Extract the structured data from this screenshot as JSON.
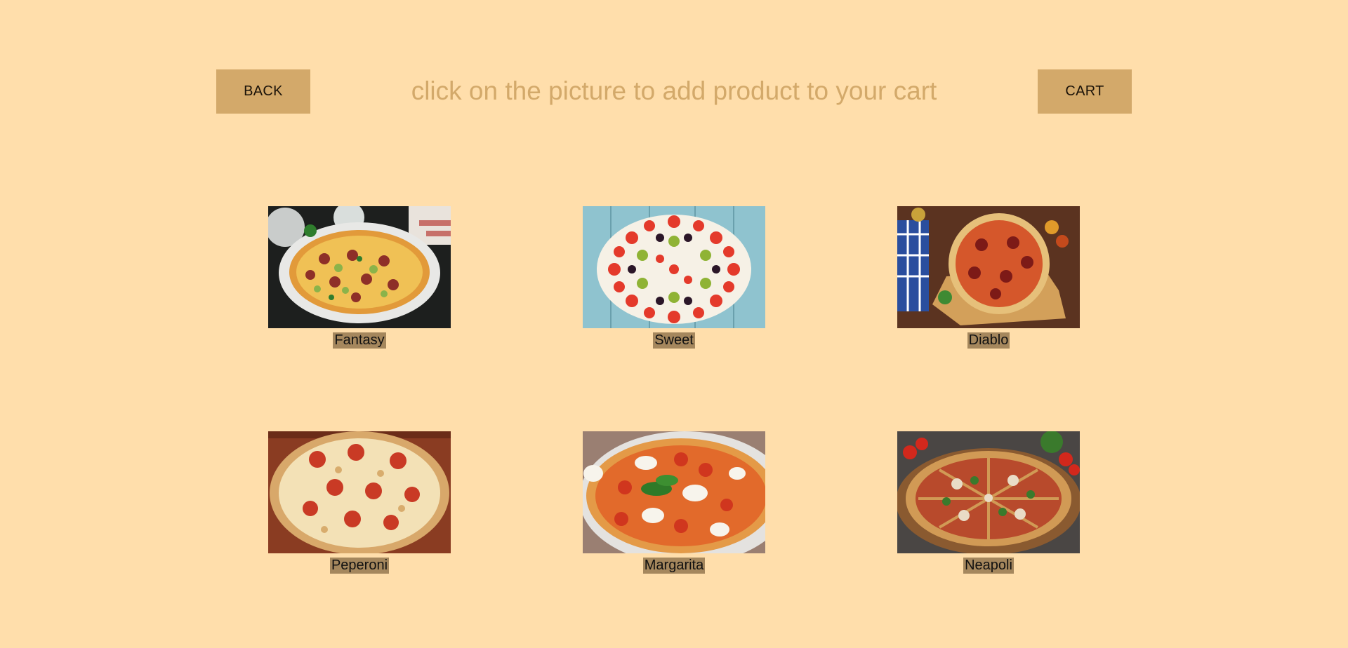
{
  "header": {
    "back_label": "BACK",
    "title": "click on the picture to add product to your cart",
    "cart_label": "CART"
  },
  "products": [
    {
      "name": "Fantasy",
      "image": "pizza-fantasy-image"
    },
    {
      "name": "Sweet",
      "image": "pizza-sweet-image"
    },
    {
      "name": "Diablo",
      "image": "pizza-diablo-image"
    },
    {
      "name": "Peperoni",
      "image": "pizza-peperoni-image"
    },
    {
      "name": "Margarita",
      "image": "pizza-margarita-image"
    },
    {
      "name": "Neapoli",
      "image": "pizza-neapoli-image"
    }
  ],
  "colors": {
    "background": "#ffdeab",
    "accent": "#d3a96a",
    "label_bg": "#a5875d"
  }
}
